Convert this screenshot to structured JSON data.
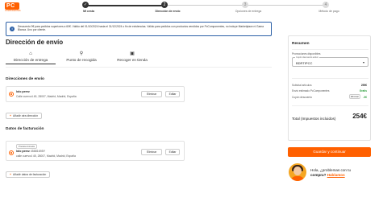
{
  "header": {
    "logo_text": "PC",
    "logo_sub": "COMPONENTES",
    "steps": [
      {
        "number": "✓",
        "label": "Mi cesta",
        "state": "done"
      },
      {
        "number": "2",
        "label": "Dirección de envío",
        "state": "active"
      },
      {
        "number": "3",
        "label": "Opciones de entrega",
        "state": "todo"
      },
      {
        "number": "4",
        "label": "Método de pago",
        "state": "todo"
      }
    ]
  },
  "banner": {
    "icon": "info-icon",
    "text": "Descuento 9€ para pedidos superiores a 60€. Válido del 01/10/2024 hasta el 31/12/2024 o fin de existencias. Válido para pedidos con productos vendidos por PcComponentes, no incluye Marketplace ni Gama Blanca. Uno por cliente."
  },
  "shipping": {
    "title": "Dirección de envío",
    "tabs": [
      {
        "icon": "home-icon",
        "label": "Dirección de entrega",
        "active": true
      },
      {
        "icon": "location-pin-icon",
        "label": "Punto de recogida",
        "active": false
      },
      {
        "icon": "store-icon",
        "label": "Recoger en tienda",
        "active": false
      }
    ],
    "section_title": "Direcciones de envío",
    "address": {
      "name": "lolo perez",
      "line": "Calle cuervo4 45, 28007, Madrid, Madrid, España",
      "delete_label": "Eliminar",
      "edit_label": "Editar"
    },
    "add_label": "Añadir otra dirección"
  },
  "billing": {
    "section_title": "Datos de facturación",
    "address": {
      "badge": "Predeterminada",
      "name": "lolo perez",
      "nif": "45881695Y",
      "line": "calle cuervo4 45, 28007, Madrid, Madrid, España",
      "delete_label": "Eliminar",
      "edit_label": "Editar"
    },
    "add_label": "Añadir datos de facturación"
  },
  "summary": {
    "title": "Resumen",
    "promo_label": "Promociones disponibles",
    "coupon_label": "Cupón descuento activo",
    "coupon_value": "BDRTIPCC",
    "rows": [
      {
        "label": "Subtotal artículos",
        "value": "259€",
        "style": "normal"
      },
      {
        "label": "Envío estimado PcComponentes",
        "value": "Gratis",
        "style": "green"
      },
      {
        "label": "Cupón descuento",
        "value": "-9€",
        "style": "green",
        "action": "Eliminar"
      }
    ],
    "total_label": "Total (Impuestos incluidos)",
    "total_value": "254€",
    "checkout_label": "Guardar y continuar"
  },
  "help": {
    "line1": "Hola, ¿problemas con tu",
    "line2": "compra?",
    "link": "Hablamos"
  },
  "colors": {
    "accent": "#ff6000",
    "info": "#2b5fa6",
    "success": "#2e9e3e"
  }
}
